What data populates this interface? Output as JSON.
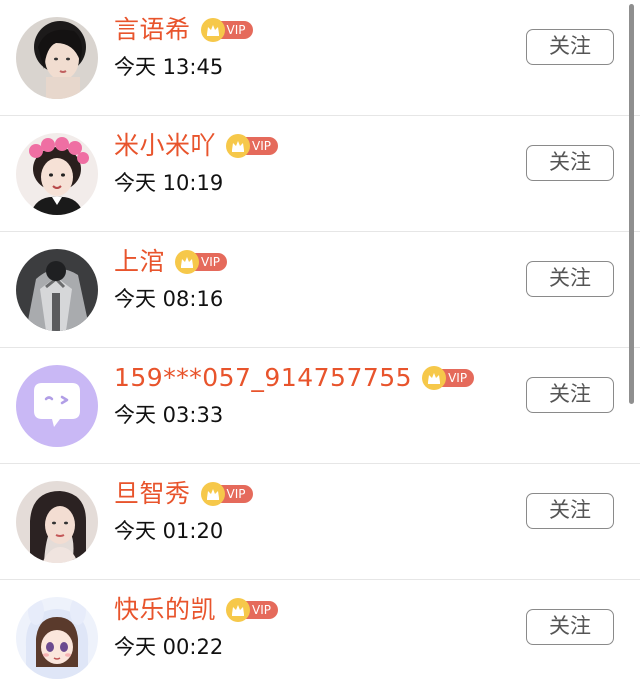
{
  "follow_label": "关注",
  "vip_label": "VIP",
  "colors": {
    "name": "#e8542c",
    "vip_badge": "#e56a5b",
    "crown": "#f6c84a"
  },
  "users": [
    {
      "name": "言语希",
      "time": "今天 13:45",
      "avatar": "woman-dark-hair-photo"
    },
    {
      "name": "米小米吖",
      "time": "今天 10:19",
      "avatar": "girl-pink-hair-rollers-photo"
    },
    {
      "name": "上涫",
      "time": "今天 08:16",
      "avatar": "person-metallic-jacket-photo"
    },
    {
      "name": "159***057_914757755",
      "time": "今天 03:33",
      "avatar": "default-chat-bubble-avatar"
    },
    {
      "name": "旦智秀",
      "time": "今天 01:20",
      "avatar": "woman-portrait-photo"
    },
    {
      "name": "快乐的凯",
      "time": "今天 00:22",
      "avatar": "anime-girl-bunny-hood"
    }
  ]
}
